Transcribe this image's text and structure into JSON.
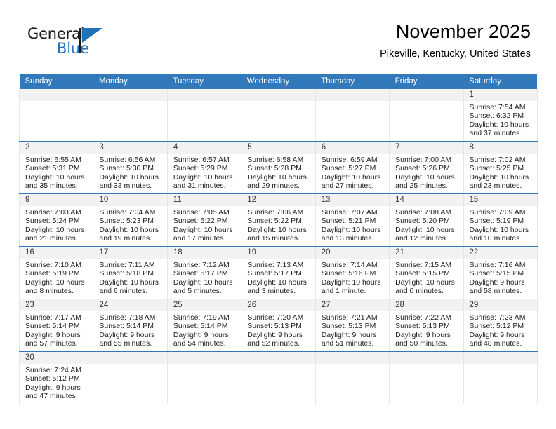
{
  "brand": {
    "name_primary": "General",
    "name_secondary": "Blue"
  },
  "header": {
    "title": "November 2025",
    "subtitle": "Pikeville, Kentucky, United States"
  },
  "colors": {
    "header_blue": "#3279bb",
    "daynum_band": "#f2f2f2",
    "brand_blue": "#1f72b8"
  },
  "weekdays": [
    "Sunday",
    "Monday",
    "Tuesday",
    "Wednesday",
    "Thursday",
    "Friday",
    "Saturday"
  ],
  "labels": {
    "sunrise": "Sunrise:",
    "sunset": "Sunset:",
    "daylight": "Daylight:"
  },
  "weeks": [
    [
      {
        "day": ""
      },
      {
        "day": ""
      },
      {
        "day": ""
      },
      {
        "day": ""
      },
      {
        "day": ""
      },
      {
        "day": ""
      },
      {
        "day": "1",
        "sunrise": "Sunrise: 7:54 AM",
        "sunset": "Sunset: 6:32 PM",
        "daylight_1": "Daylight: 10 hours",
        "daylight_2": "and 37 minutes."
      }
    ],
    [
      {
        "day": "2",
        "sunrise": "Sunrise: 6:55 AM",
        "sunset": "Sunset: 5:31 PM",
        "daylight_1": "Daylight: 10 hours",
        "daylight_2": "and 35 minutes."
      },
      {
        "day": "3",
        "sunrise": "Sunrise: 6:56 AM",
        "sunset": "Sunset: 5:30 PM",
        "daylight_1": "Daylight: 10 hours",
        "daylight_2": "and 33 minutes."
      },
      {
        "day": "4",
        "sunrise": "Sunrise: 6:57 AM",
        "sunset": "Sunset: 5:29 PM",
        "daylight_1": "Daylight: 10 hours",
        "daylight_2": "and 31 minutes."
      },
      {
        "day": "5",
        "sunrise": "Sunrise: 6:58 AM",
        "sunset": "Sunset: 5:28 PM",
        "daylight_1": "Daylight: 10 hours",
        "daylight_2": "and 29 minutes."
      },
      {
        "day": "6",
        "sunrise": "Sunrise: 6:59 AM",
        "sunset": "Sunset: 5:27 PM",
        "daylight_1": "Daylight: 10 hours",
        "daylight_2": "and 27 minutes."
      },
      {
        "day": "7",
        "sunrise": "Sunrise: 7:00 AM",
        "sunset": "Sunset: 5:26 PM",
        "daylight_1": "Daylight: 10 hours",
        "daylight_2": "and 25 minutes."
      },
      {
        "day": "8",
        "sunrise": "Sunrise: 7:02 AM",
        "sunset": "Sunset: 5:25 PM",
        "daylight_1": "Daylight: 10 hours",
        "daylight_2": "and 23 minutes."
      }
    ],
    [
      {
        "day": "9",
        "sunrise": "Sunrise: 7:03 AM",
        "sunset": "Sunset: 5:24 PM",
        "daylight_1": "Daylight: 10 hours",
        "daylight_2": "and 21 minutes."
      },
      {
        "day": "10",
        "sunrise": "Sunrise: 7:04 AM",
        "sunset": "Sunset: 5:23 PM",
        "daylight_1": "Daylight: 10 hours",
        "daylight_2": "and 19 minutes."
      },
      {
        "day": "11",
        "sunrise": "Sunrise: 7:05 AM",
        "sunset": "Sunset: 5:22 PM",
        "daylight_1": "Daylight: 10 hours",
        "daylight_2": "and 17 minutes."
      },
      {
        "day": "12",
        "sunrise": "Sunrise: 7:06 AM",
        "sunset": "Sunset: 5:22 PM",
        "daylight_1": "Daylight: 10 hours",
        "daylight_2": "and 15 minutes."
      },
      {
        "day": "13",
        "sunrise": "Sunrise: 7:07 AM",
        "sunset": "Sunset: 5:21 PM",
        "daylight_1": "Daylight: 10 hours",
        "daylight_2": "and 13 minutes."
      },
      {
        "day": "14",
        "sunrise": "Sunrise: 7:08 AM",
        "sunset": "Sunset: 5:20 PM",
        "daylight_1": "Daylight: 10 hours",
        "daylight_2": "and 12 minutes."
      },
      {
        "day": "15",
        "sunrise": "Sunrise: 7:09 AM",
        "sunset": "Sunset: 5:19 PM",
        "daylight_1": "Daylight: 10 hours",
        "daylight_2": "and 10 minutes."
      }
    ],
    [
      {
        "day": "16",
        "sunrise": "Sunrise: 7:10 AM",
        "sunset": "Sunset: 5:19 PM",
        "daylight_1": "Daylight: 10 hours",
        "daylight_2": "and 8 minutes."
      },
      {
        "day": "17",
        "sunrise": "Sunrise: 7:11 AM",
        "sunset": "Sunset: 5:18 PM",
        "daylight_1": "Daylight: 10 hours",
        "daylight_2": "and 6 minutes."
      },
      {
        "day": "18",
        "sunrise": "Sunrise: 7:12 AM",
        "sunset": "Sunset: 5:17 PM",
        "daylight_1": "Daylight: 10 hours",
        "daylight_2": "and 5 minutes."
      },
      {
        "day": "19",
        "sunrise": "Sunrise: 7:13 AM",
        "sunset": "Sunset: 5:17 PM",
        "daylight_1": "Daylight: 10 hours",
        "daylight_2": "and 3 minutes."
      },
      {
        "day": "20",
        "sunrise": "Sunrise: 7:14 AM",
        "sunset": "Sunset: 5:16 PM",
        "daylight_1": "Daylight: 10 hours",
        "daylight_2": "and 1 minute."
      },
      {
        "day": "21",
        "sunrise": "Sunrise: 7:15 AM",
        "sunset": "Sunset: 5:15 PM",
        "daylight_1": "Daylight: 10 hours",
        "daylight_2": "and 0 minutes."
      },
      {
        "day": "22",
        "sunrise": "Sunrise: 7:16 AM",
        "sunset": "Sunset: 5:15 PM",
        "daylight_1": "Daylight: 9 hours",
        "daylight_2": "and 58 minutes."
      }
    ],
    [
      {
        "day": "23",
        "sunrise": "Sunrise: 7:17 AM",
        "sunset": "Sunset: 5:14 PM",
        "daylight_1": "Daylight: 9 hours",
        "daylight_2": "and 57 minutes."
      },
      {
        "day": "24",
        "sunrise": "Sunrise: 7:18 AM",
        "sunset": "Sunset: 5:14 PM",
        "daylight_1": "Daylight: 9 hours",
        "daylight_2": "and 55 minutes."
      },
      {
        "day": "25",
        "sunrise": "Sunrise: 7:19 AM",
        "sunset": "Sunset: 5:14 PM",
        "daylight_1": "Daylight: 9 hours",
        "daylight_2": "and 54 minutes."
      },
      {
        "day": "26",
        "sunrise": "Sunrise: 7:20 AM",
        "sunset": "Sunset: 5:13 PM",
        "daylight_1": "Daylight: 9 hours",
        "daylight_2": "and 52 minutes."
      },
      {
        "day": "27",
        "sunrise": "Sunrise: 7:21 AM",
        "sunset": "Sunset: 5:13 PM",
        "daylight_1": "Daylight: 9 hours",
        "daylight_2": "and 51 minutes."
      },
      {
        "day": "28",
        "sunrise": "Sunrise: 7:22 AM",
        "sunset": "Sunset: 5:13 PM",
        "daylight_1": "Daylight: 9 hours",
        "daylight_2": "and 50 minutes."
      },
      {
        "day": "29",
        "sunrise": "Sunrise: 7:23 AM",
        "sunset": "Sunset: 5:12 PM",
        "daylight_1": "Daylight: 9 hours",
        "daylight_2": "and 48 minutes."
      }
    ],
    [
      {
        "day": "30",
        "sunrise": "Sunrise: 7:24 AM",
        "sunset": "Sunset: 5:12 PM",
        "daylight_1": "Daylight: 9 hours",
        "daylight_2": "and 47 minutes."
      },
      {
        "day": ""
      },
      {
        "day": ""
      },
      {
        "day": ""
      },
      {
        "day": ""
      },
      {
        "day": ""
      },
      {
        "day": ""
      }
    ]
  ]
}
